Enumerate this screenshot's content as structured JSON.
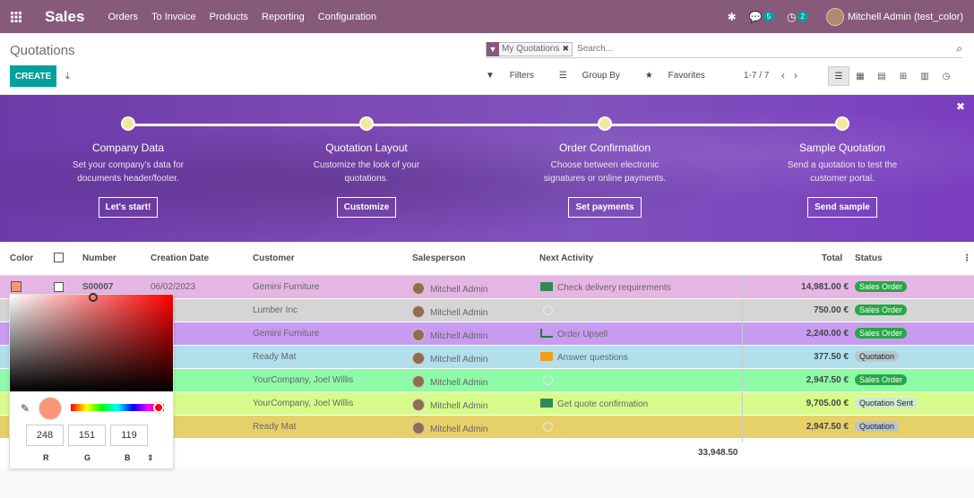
{
  "navbar": {
    "app_name": "Sales",
    "menu": [
      "Orders",
      "To Invoice",
      "Products",
      "Reporting",
      "Configuration"
    ],
    "messages_count": "5",
    "activities_count": "2",
    "user": "Mitchell Admin (test_color)"
  },
  "control": {
    "title": "Quotations",
    "create_label": "CREATE",
    "facet": "My Quotations",
    "search_placeholder": "Search...",
    "filters_label": "Filters",
    "groupby_label": "Group By",
    "favorites_label": "Favorites",
    "pager": "1-7 / 7"
  },
  "banner": {
    "steps": [
      {
        "title": "Company Data",
        "desc1": "Set your company's data for",
        "desc2": "documents header/footer.",
        "button": "Let's start!"
      },
      {
        "title": "Quotation Layout",
        "desc1": "Customize the look of your",
        "desc2": "quotations.",
        "button": "Customize"
      },
      {
        "title": "Order Confirmation",
        "desc1": "Choose between electronic",
        "desc2": "signatures or online payments.",
        "button": "Set payments"
      },
      {
        "title": "Sample Quotation",
        "desc1": "Send a quotation to test the",
        "desc2": "customer portal.",
        "button": "Send sample"
      }
    ]
  },
  "table": {
    "headers": {
      "color": "Color",
      "number": "Number",
      "creation_date": "Creation Date",
      "customer": "Customer",
      "salesperson": "Salesperson",
      "next_activity": "Next Activity",
      "total": "Total",
      "status": "Status"
    },
    "rows": [
      {
        "bg": "#e5b6e4",
        "number": "S00007",
        "date": "06/02/2023",
        "customer": "Gemini Furniture",
        "salesperson": "Mitchell Admin",
        "activity": "Check delivery requirements",
        "activity_icon": "spreadsheet-icon",
        "total": "14,981.00 €",
        "status": "Sales Order"
      },
      {
        "bg": "#d5d5d5",
        "number": "",
        "date": "/2023",
        "customer": "Lumber Inc",
        "salesperson": "Mitchell Admin",
        "activity": "",
        "activity_icon": "clock-icon",
        "total": "750.00 €",
        "status": "Sales Order"
      },
      {
        "bg": "#c79cf0",
        "number": "",
        "date": "/2023",
        "customer": "Gemini Furniture",
        "salesperson": "Mitchell Admin",
        "activity": "Order Upsell",
        "activity_icon": "chart-icon",
        "total": "2,240.00 €",
        "status": "Sales Order"
      },
      {
        "bg": "#b2dfec",
        "number": "",
        "date": "/2023",
        "customer": "Ready Mat",
        "salesperson": "Mitchell Admin",
        "activity": "Answer questions",
        "activity_icon": "envelope-icon",
        "total": "377.50 €",
        "status": "Quotation"
      },
      {
        "bg": "#8dfba8",
        "number": "",
        "date": "/2023",
        "customer": "YourCompany, Joel Willis",
        "salesperson": "Mitchell Admin",
        "activity": "",
        "activity_icon": "clock-icon",
        "total": "2,947.50 €",
        "status": "Sales Order"
      },
      {
        "bg": "#d8fc8b",
        "number": "",
        "date": "/2023",
        "customer": "YourCompany, Joel Willis",
        "salesperson": "Mitchell Admin",
        "activity": "Get quote confirmation",
        "activity_icon": "spreadsheet-icon",
        "total": "9,705.00 €",
        "status": "Quotation Sent"
      },
      {
        "bg": "#e7d06a",
        "number": "",
        "date": "/2023",
        "customer": "Ready Mat",
        "salesperson": "Mitchell Admin",
        "activity": "",
        "activity_icon": "clock-icon",
        "total": "2,947.50 €",
        "status": "Quotation"
      }
    ],
    "sum_total": "33,948.50"
  },
  "color_picker": {
    "r": "248",
    "g": "151",
    "b": "119",
    "r_label": "R",
    "g_label": "G",
    "b_label": "B",
    "current_color": "#f89777"
  },
  "colors": {
    "brand": "#875a7b",
    "accent": "#00a09d"
  }
}
